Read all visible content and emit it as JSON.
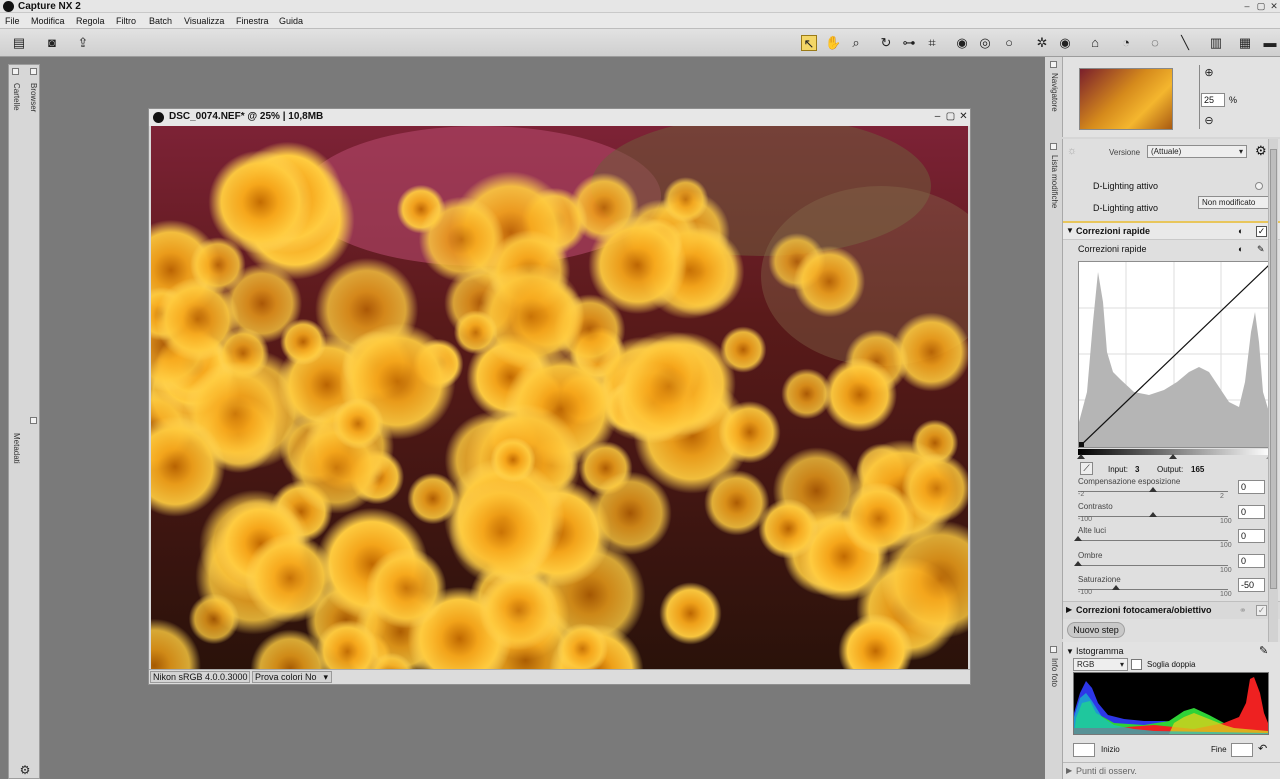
{
  "window": {
    "title": "Capture NX 2"
  },
  "menu": [
    "File",
    "Modifica",
    "Regola",
    "Filtro",
    "Batch",
    "Visualizza",
    "Finestra",
    "Guida"
  ],
  "left_dock": {
    "tabs": [
      "Cartelle",
      "Browser",
      "Metadati"
    ]
  },
  "image_window": {
    "title": "DSC_0074.NEF* @ 25% | 10,8MB",
    "profile": "Nikon sRGB 4.0.0.3000",
    "soft_proof": "Prova colori No"
  },
  "navigator": {
    "label": "Navigatore",
    "zoom_value": "25",
    "zoom_unit": "%"
  },
  "edit_list": {
    "label": "Lista modifiche",
    "version_label": "Versione",
    "version_value": "(Attuale)",
    "d_lighting_1": "D-Lighting attivo",
    "d_lighting_2": "D-Lighting attivo",
    "d_lighting_value": "Non modificato",
    "section_title": "Correzioni rapide",
    "sub_title": "Correzioni rapide",
    "input_label": "Input:",
    "input_value": "3",
    "output_label": "Output:",
    "output_value": "165",
    "sliders": [
      {
        "label": "Compensazione esposizione",
        "min": "-2",
        "max": "2",
        "value": "0",
        "pos": 0.5
      },
      {
        "label": "Contrasto",
        "min": "-100",
        "max": "100",
        "value": "0",
        "pos": 0.5
      },
      {
        "label": "Alte luci",
        "min": "",
        "max": "100",
        "value": "0",
        "pos": 0.0
      },
      {
        "label": "Ombre",
        "min": "",
        "max": "100",
        "value": "0",
        "pos": 0.0
      },
      {
        "label": "Saturazione",
        "min": "-100",
        "max": "100",
        "value": "-50",
        "pos": 0.25
      }
    ],
    "camera_section": "Correzioni fotocamera/obiettivo",
    "new_step": "Nuovo step"
  },
  "info_panel": {
    "label": "Info foto",
    "histogram_title": "Istogramma",
    "channel": "RGB",
    "double_threshold": "Soglia doppia",
    "start_label": "Inizio",
    "end_label": "Fine",
    "watch_points": "Punti di osserv."
  }
}
